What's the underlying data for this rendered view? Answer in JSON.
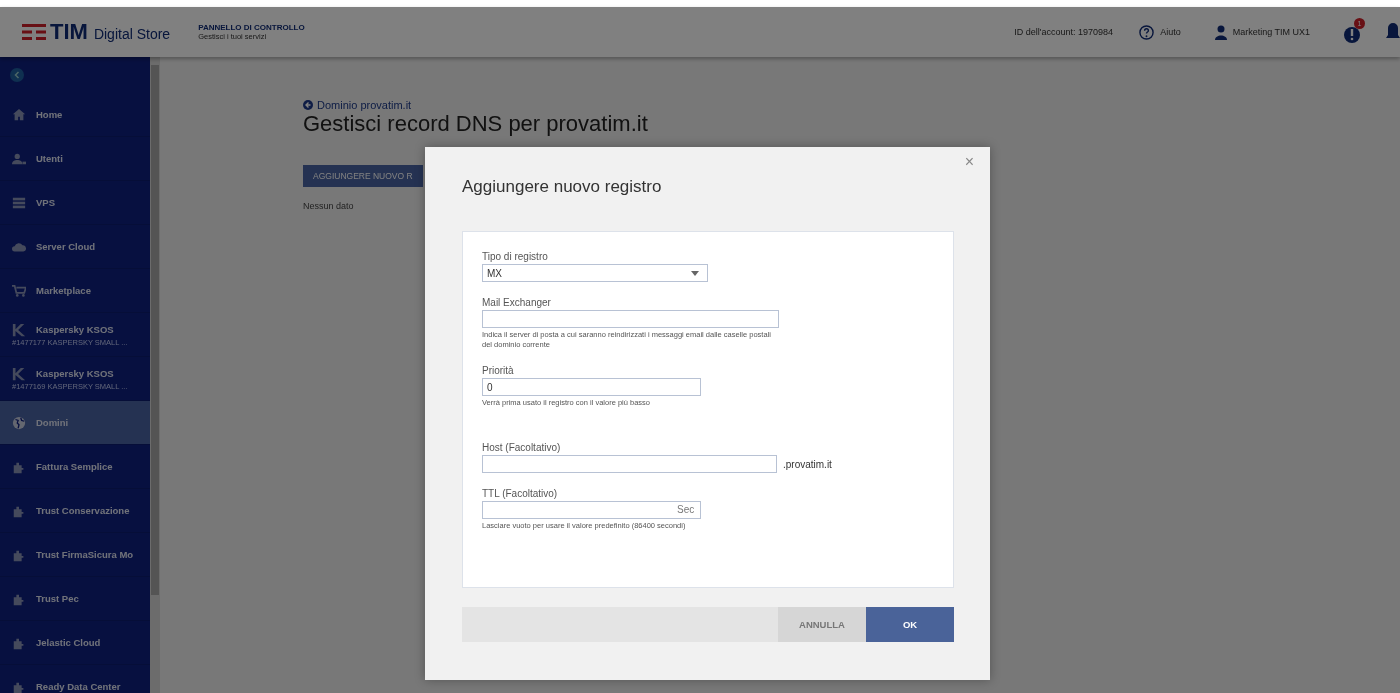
{
  "header": {
    "logo_text": "TIM",
    "logo_subtitle": "Digital Store",
    "panel_title": "PANNELLO DI CONTROLLO",
    "panel_subtitle": "Gestisci i tuoi servizi",
    "account_id": "ID dell'account: 1970984",
    "help": "Aiuto",
    "user": "Marketing TIM UX1",
    "notification_count": "1"
  },
  "sidebar": {
    "items": [
      {
        "kind": "home",
        "label": "Home",
        "selected": false
      },
      {
        "kind": "users",
        "label": "Utenti",
        "selected": false
      },
      {
        "kind": "server",
        "label": "VPS",
        "selected": false
      },
      {
        "kind": "cloud",
        "label": "Server Cloud",
        "selected": false
      },
      {
        "kind": "cart",
        "label": "Marketplace",
        "selected": false
      },
      {
        "kind": "kaspersky",
        "label": "Kaspersky KSOS",
        "sublabel": "#1477177 KASPERSKY SMALL ...",
        "selected": false
      },
      {
        "kind": "kaspersky",
        "label": "Kaspersky KSOS",
        "sublabel": "#1477169 KASPERSKY SMALL ...",
        "selected": false
      },
      {
        "kind": "globe",
        "label": "Domini",
        "selected": true
      },
      {
        "kind": "puzzle",
        "label": "Fattura Semplice",
        "selected": false
      },
      {
        "kind": "puzzle",
        "label": "Trust Conservazione",
        "selected": false
      },
      {
        "kind": "puzzle",
        "label": "Trust FirmaSicura Mo",
        "selected": false
      },
      {
        "kind": "puzzle",
        "label": "Trust Pec",
        "selected": false
      },
      {
        "kind": "puzzle",
        "label": "Jelastic Cloud",
        "selected": false
      },
      {
        "kind": "puzzle",
        "label": "Ready Data Center",
        "selected": false
      }
    ]
  },
  "page": {
    "back_link": "Dominio provatim.it",
    "title": "Gestisci record DNS per provatim.it",
    "add_button": "AGGIUNGERE NUOVO R",
    "empty_text": "Nessun dato"
  },
  "dialog": {
    "title": "Aggiungere nuovo registro",
    "close": "×",
    "fields": [
      {
        "kind": "select",
        "label": "Tipo di registro",
        "value": "MX"
      },
      {
        "kind": "text",
        "label": "Mail Exchanger",
        "hint": "Indica il server di posta a cui saranno reindirizzati i messaggi email dalle caselle postali del dominio corrente"
      },
      {
        "kind": "text",
        "label": "Priorità",
        "value": "0",
        "hint": "Verrà prima usato il registro con il valore più basso"
      },
      {
        "kind": "text",
        "label": "Host (Facoltativo)",
        "suffix": ".provatim.it"
      },
      {
        "kind": "text",
        "label": "TTL (Facoltativo)",
        "unit": "Sec",
        "hint": "Lasciare vuoto per usare il valore predefinito (86400 secondi)"
      }
    ],
    "cancel": "ANNULLA",
    "ok": "OK"
  }
}
